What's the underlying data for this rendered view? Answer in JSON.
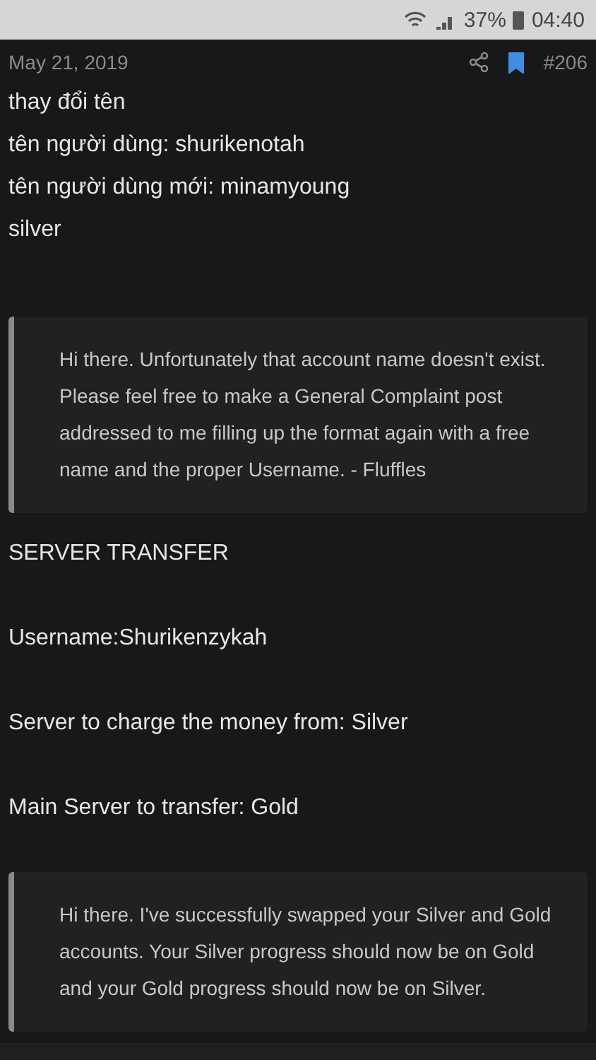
{
  "status_bar": {
    "battery": "37%",
    "time": "04:40"
  },
  "post": {
    "date": "May 21, 2019",
    "number": "#206",
    "bookmarked": true,
    "lines": [
      "thay đổi tên",
      "tên người dùng: shurikenotah",
      "tên người dùng mới: minamyoung",
      "silver"
    ],
    "quote": "Hi there. Unfortunately that account name doesn't exist. Please feel free to make a General Complaint post addressed to me filling up the format again with a free name and the proper Username. - Fluffles"
  },
  "next_post": {
    "paragraphs": [
      "SERVER TRANSFER",
      "Username:Shurikenzykah",
      "Server to charge the money from: Silver",
      "Main Server to transfer: Gold"
    ],
    "quote": "Hi there. I've successfully swapped your Silver and Gold accounts. Your Silver progress should now be on Gold and your Gold progress should now be on Silver."
  }
}
